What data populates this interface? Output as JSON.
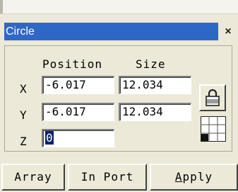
{
  "panel": {
    "title": "Circle",
    "close_glyph": "×"
  },
  "columns": {
    "position": "Position",
    "size": "Size"
  },
  "rows": [
    {
      "label": "X",
      "position": "-6.017",
      "size": "12.034"
    },
    {
      "label": "Y",
      "position": "-6.017",
      "size": "12.034"
    },
    {
      "label": "Z",
      "position": "0"
    }
  ],
  "icons": {
    "lock": "lock-icon",
    "grid": "grid-icon"
  },
  "buttons": {
    "array": "Array",
    "import": "In Port",
    "apply_access": "A",
    "apply_rest": "pply"
  },
  "colors": {
    "title_bar": "#2f67c6",
    "selection": "#0a246a",
    "panel_bg": "#ece9d8"
  }
}
